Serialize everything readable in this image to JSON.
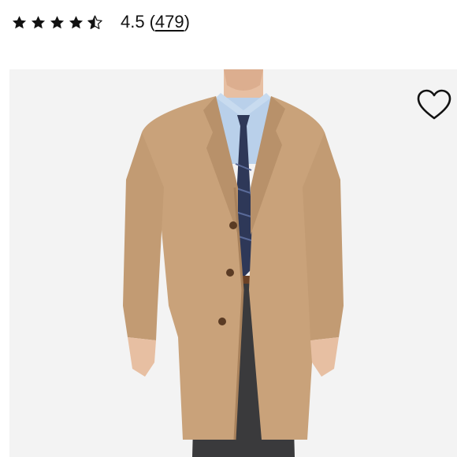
{
  "rating": {
    "stars_value": 4.5,
    "stars_max": 5,
    "value_text": "4.5",
    "count_open": "(",
    "count_text": "479",
    "count_close": ")"
  },
  "wishlist": {
    "icon": "heart-outline-icon"
  },
  "product_image": {
    "subject": "camel-overcoat-model"
  },
  "colors": {
    "coat": "#c9a27a",
    "coat_shadow": "#a9825c",
    "shirt": "#b9d0ea",
    "tie": "#2e3858",
    "trousers": "#3a3a3c",
    "skin": "#e7bfa2",
    "background": "#f3f3f3"
  }
}
